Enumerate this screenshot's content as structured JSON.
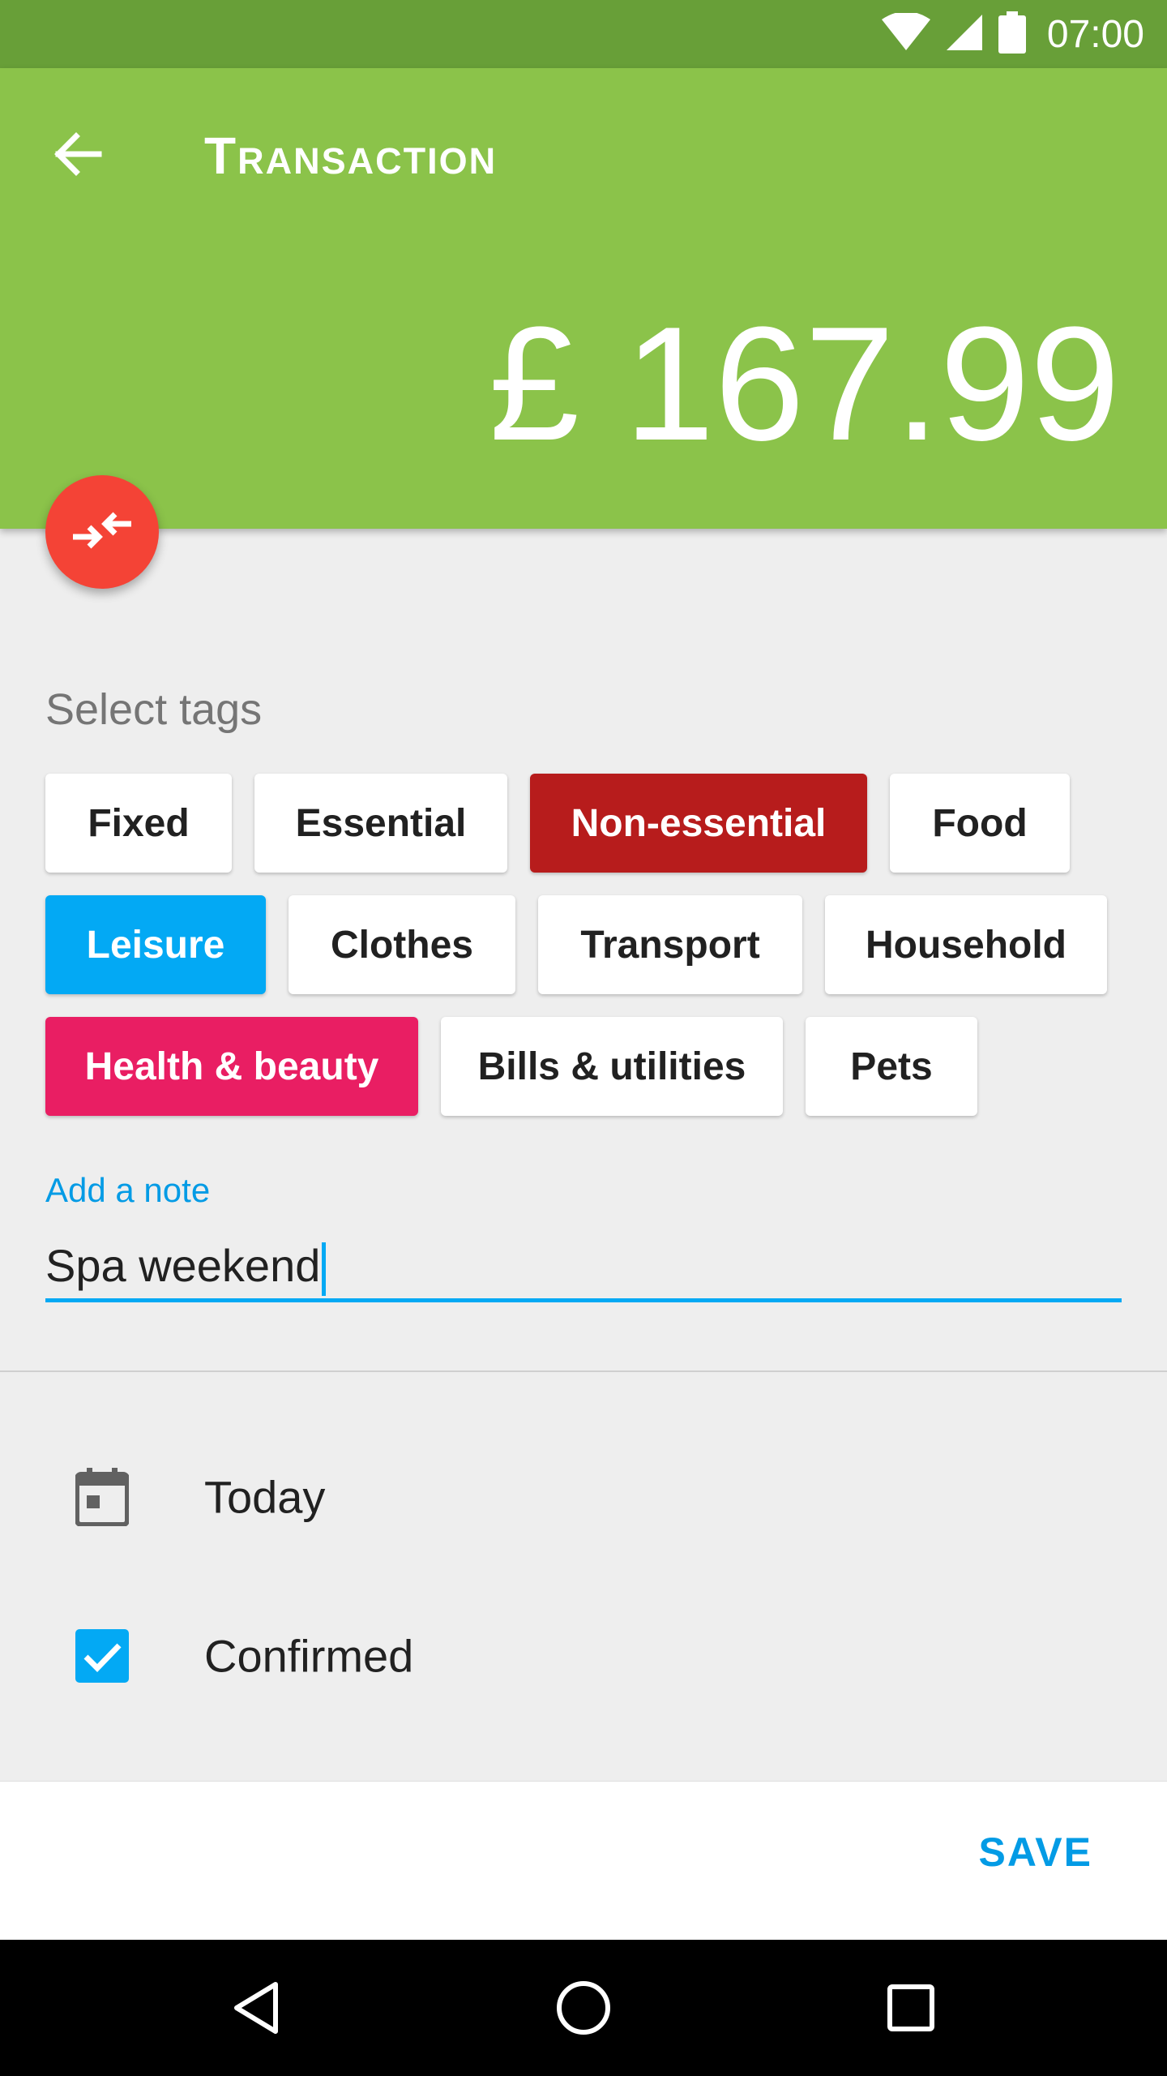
{
  "status_bar": {
    "time": "07:00",
    "icons": [
      "wifi-icon",
      "signal-icon",
      "battery-icon"
    ]
  },
  "app_bar": {
    "title": "Transaction",
    "amount": "£ 167.99",
    "back_icon": "arrow-back-icon"
  },
  "fab": {
    "icon": "transfer-arrows-icon"
  },
  "tags": {
    "label": "Select tags",
    "items": [
      {
        "label": "Fixed",
        "selected": false
      },
      {
        "label": "Essential",
        "selected": false
      },
      {
        "label": "Non-essential",
        "selected": true,
        "color": "#b71c1c"
      },
      {
        "label": "Food",
        "selected": false
      },
      {
        "label": "Leisure",
        "selected": true,
        "color": "#03a9f4"
      },
      {
        "label": "Clothes",
        "selected": false
      },
      {
        "label": "Transport",
        "selected": false
      },
      {
        "label": "Household",
        "selected": false
      },
      {
        "label": "Health & beauty",
        "selected": true,
        "color": "#e91e63"
      },
      {
        "label": "Bills & utilities",
        "selected": false
      },
      {
        "label": "Pets",
        "selected": false
      }
    ]
  },
  "note": {
    "label": "Add a note",
    "value": "Spa weekend"
  },
  "date_row": {
    "icon": "calendar-icon",
    "label": "Today"
  },
  "confirmed_row": {
    "icon": "checkbox-checked-icon",
    "label": "Confirmed",
    "checked": true
  },
  "actions": {
    "save_label": "SAVE"
  },
  "nav_bar": {
    "icons": [
      "back-triangle-icon",
      "home-circle-icon",
      "recents-square-icon"
    ]
  },
  "colors": {
    "app_bar": "#8bc34a",
    "status_bar": "#689f38",
    "fab": "#f44336",
    "accent": "#03a9f4"
  }
}
